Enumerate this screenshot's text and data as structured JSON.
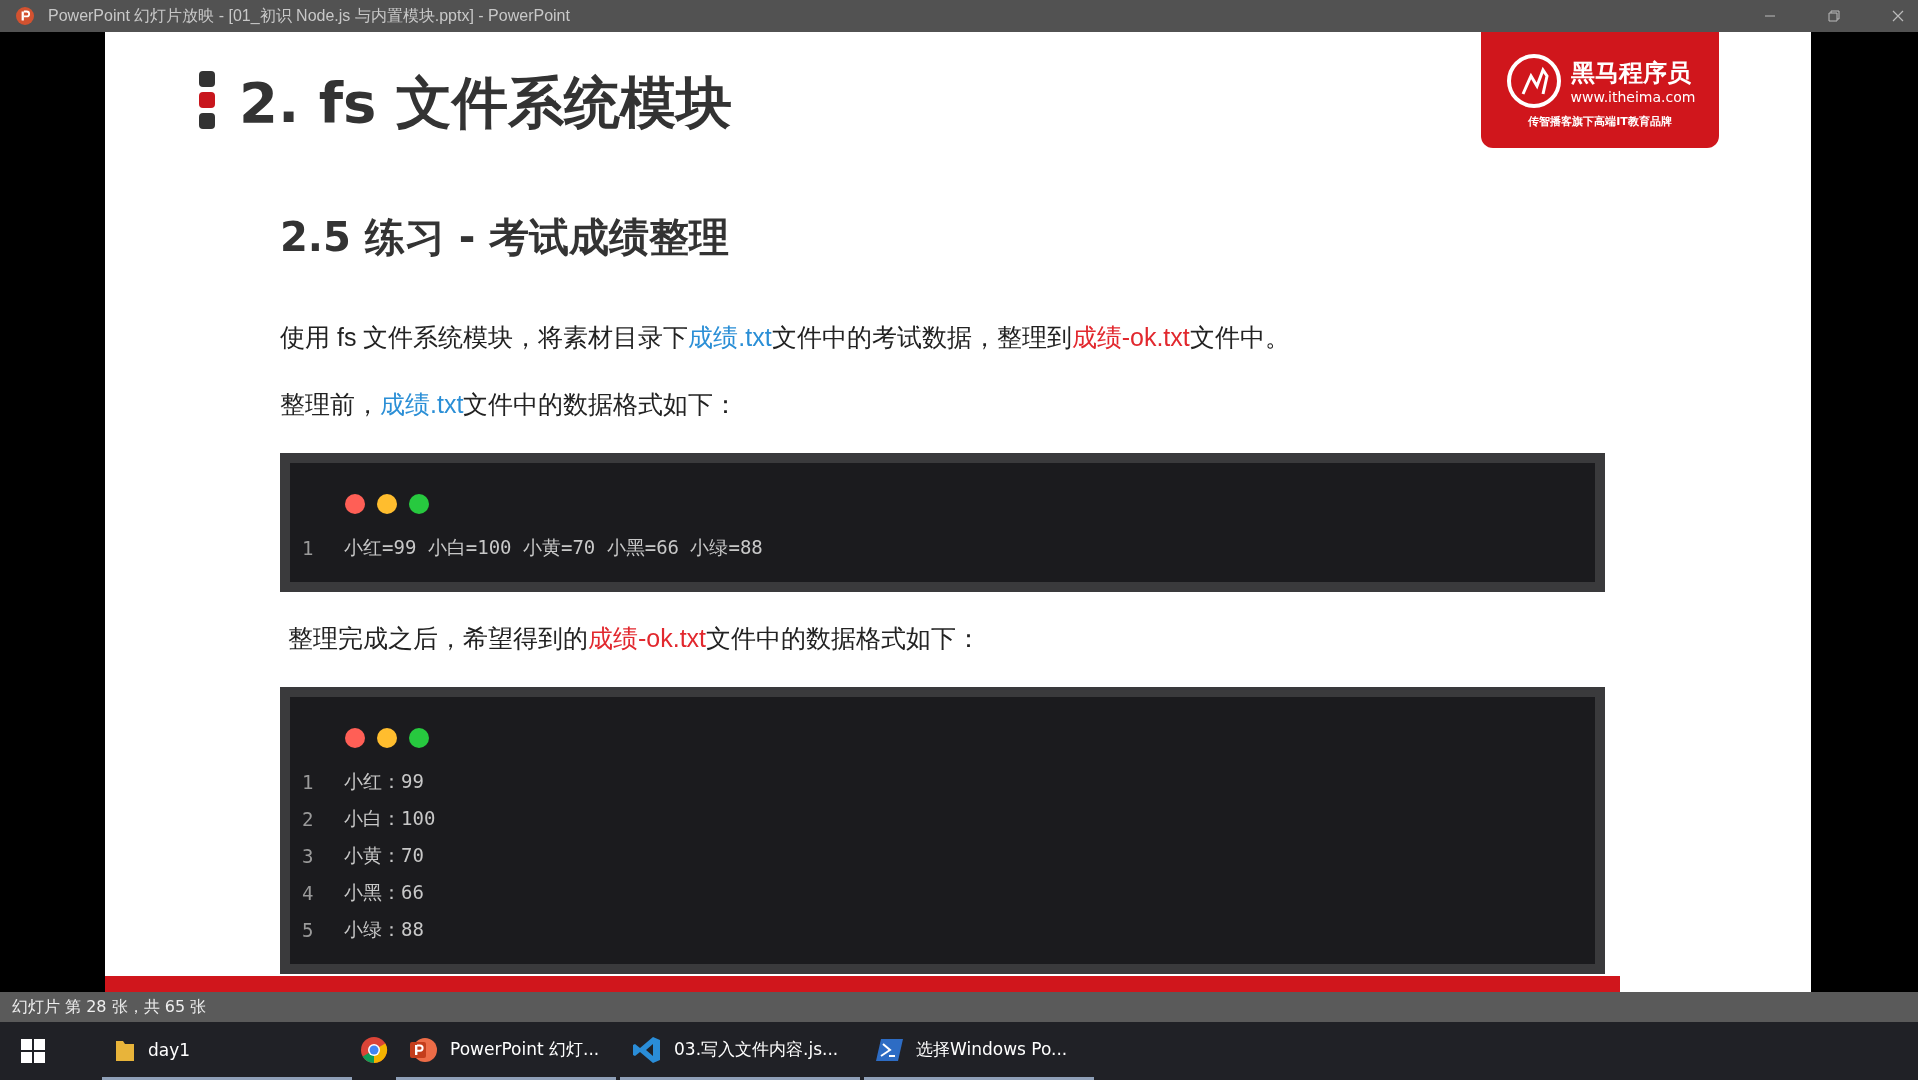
{
  "window": {
    "title": "PowerPoint 幻灯片放映 - [01_初识 Node.js 与内置模块.pptx] - PowerPoint"
  },
  "slide": {
    "heading": "2. fs 文件系统模块",
    "logo": {
      "name": "黑马程序员",
      "url": "www.itheima.com",
      "tagline": "传智播客旗下高端IT教育品牌"
    },
    "subheading": "2.5 练习 - 考试成绩整理",
    "paragraphs": [
      {
        "segments": [
          {
            "kind": "plain",
            "text": "使用 fs 文件系统模块，将素材目录下"
          },
          {
            "kind": "source",
            "text": "成绩.txt"
          },
          {
            "kind": "plain",
            "text": "文件中的考试数据，整理到"
          },
          {
            "kind": "target",
            "text": "成绩-ok.txt"
          },
          {
            "kind": "plain",
            "text": "文件中。"
          }
        ]
      },
      {
        "segments": [
          {
            "kind": "plain",
            "text": "整理前，"
          },
          {
            "kind": "source",
            "text": "成绩.txt"
          },
          {
            "kind": "plain",
            "text": "文件中的数据格式如下："
          }
        ]
      },
      {
        "segments": [
          {
            "kind": "plain",
            "text": "整理完成之后，希望得到的"
          },
          {
            "kind": "target",
            "text": "成绩-ok.txt"
          },
          {
            "kind": "plain",
            "text": "文件中的数据格式如下："
          }
        ]
      }
    ],
    "code_blocks": [
      {
        "lines": [
          {
            "number": "1",
            "text": "小红=99 小白=100 小黄=70 小黑=66 小绿=88"
          }
        ]
      },
      {
        "lines": [
          {
            "number": "1",
            "text": "小红：99"
          },
          {
            "number": "2",
            "text": "小白：100"
          },
          {
            "number": "3",
            "text": "小黄：70"
          },
          {
            "number": "4",
            "text": "小黑：66"
          },
          {
            "number": "5",
            "text": "小绿：88"
          }
        ]
      }
    ]
  },
  "status_bar": {
    "text": "幻灯片 第 28 张，共 65 张"
  },
  "taskbar": {
    "items": [
      {
        "kind": "folder",
        "label": "day1"
      },
      {
        "kind": "chrome"
      },
      {
        "kind": "powerpoint",
        "label": "PowerPoint 幻灯..."
      },
      {
        "kind": "vscode",
        "label": "03.写入文件内容.js..."
      },
      {
        "kind": "powershell",
        "label": "选择Windows Po..."
      }
    ]
  }
}
